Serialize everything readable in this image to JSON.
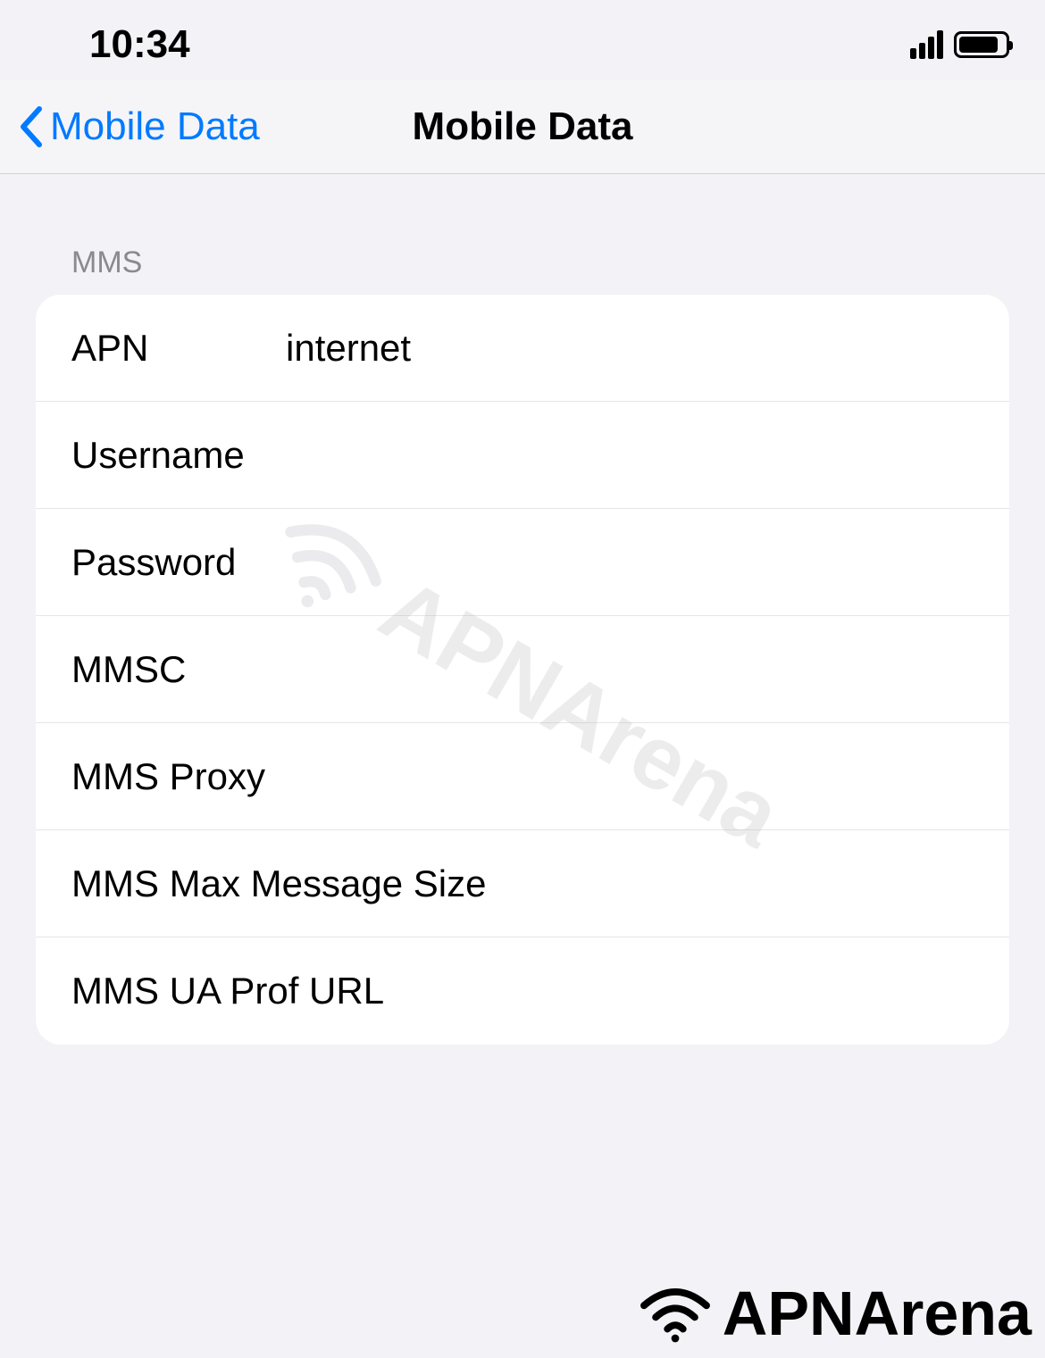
{
  "status_bar": {
    "time": "10:34"
  },
  "nav": {
    "back_label": "Mobile Data",
    "title": "Mobile Data"
  },
  "section": {
    "header": "MMS"
  },
  "fields": {
    "apn": {
      "label": "APN",
      "value": "internet"
    },
    "username": {
      "label": "Username",
      "value": ""
    },
    "password": {
      "label": "Password",
      "value": ""
    },
    "mmsc": {
      "label": "MMSC",
      "value": ""
    },
    "mms_proxy": {
      "label": "MMS Proxy",
      "value": ""
    },
    "mms_max_msg": {
      "label": "MMS Max Message Size",
      "value": ""
    },
    "mms_ua_prof": {
      "label": "MMS UA Prof URL",
      "value": ""
    }
  },
  "watermark": {
    "text": "APNArena"
  }
}
